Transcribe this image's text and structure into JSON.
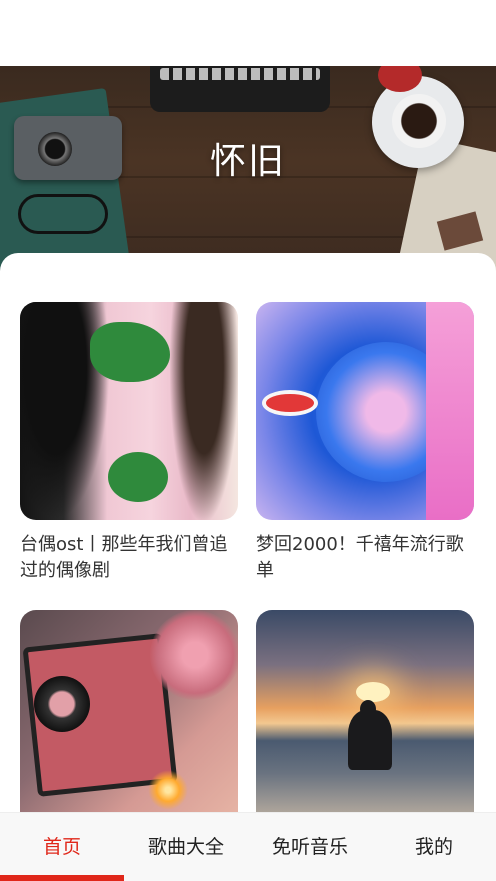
{
  "hero": {
    "title": "怀旧"
  },
  "playlists": [
    {
      "title": "台偶ost丨那些年我们曾追过的偶像剧"
    },
    {
      "title": "梦回2000！千禧年流行歌单"
    },
    {
      "title": ""
    },
    {
      "title": ""
    }
  ],
  "tabbar": {
    "tabs": [
      {
        "label": "首页",
        "active": true
      },
      {
        "label": "歌曲大全",
        "active": false
      },
      {
        "label": "免听音乐",
        "active": false
      },
      {
        "label": "我的",
        "active": false
      }
    ],
    "accent_color": "#e0271a"
  }
}
